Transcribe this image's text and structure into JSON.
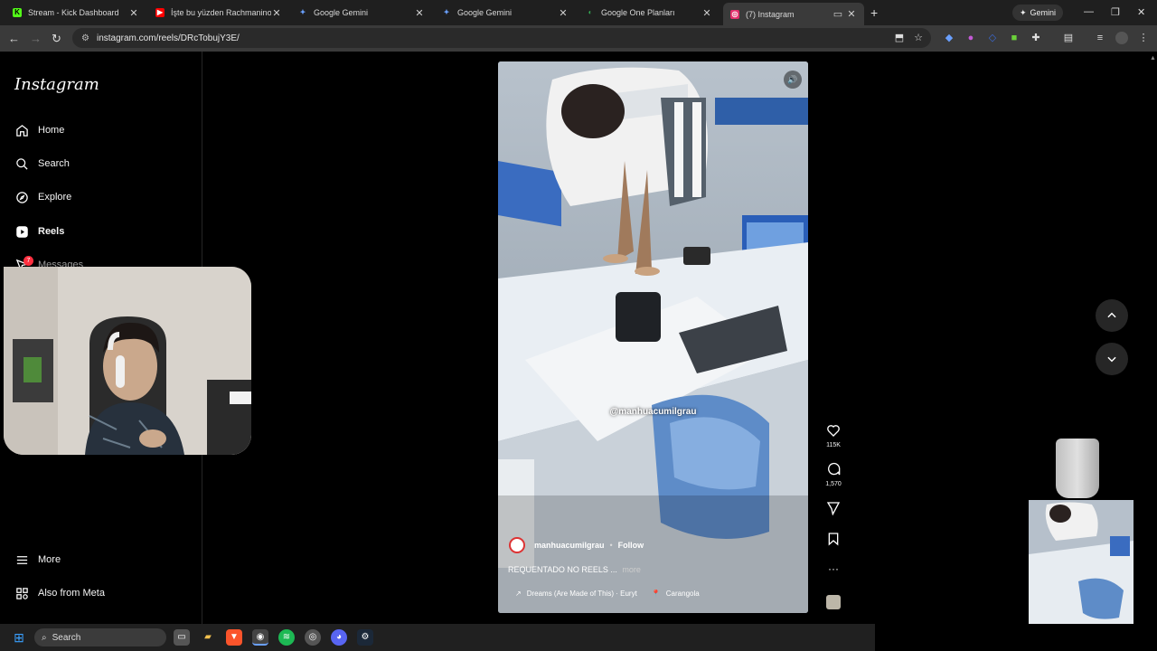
{
  "browser": {
    "tabs": [
      {
        "label": "Stream - Kick Dashboard",
        "icon": "kick-icon",
        "color": "#53fc18"
      },
      {
        "label": "İşte bu yüzden Rachmaninoff E",
        "icon": "youtube-icon",
        "color": "#ff0000"
      },
      {
        "label": "Google Gemini",
        "icon": "gemini-icon",
        "color": "#4a90e2"
      },
      {
        "label": "Google Gemini",
        "icon": "gemini-icon",
        "color": "#4a90e2"
      },
      {
        "label": "Google One Planları",
        "icon": "google-one-icon",
        "color": "#34a853"
      },
      {
        "label": "(7) Instagram",
        "icon": "instagram-icon",
        "color": "#e1306c"
      }
    ],
    "gemini_button": "Gemini",
    "url": "instagram.com/reels/DRcTobujY3E/"
  },
  "instagram": {
    "logo": "Instagram",
    "nav": [
      {
        "label": "Home",
        "icon": "home-icon"
      },
      {
        "label": "Search",
        "icon": "search-icon"
      },
      {
        "label": "Explore",
        "icon": "compass-icon"
      },
      {
        "label": "Reels",
        "icon": "reels-icon"
      },
      {
        "label": "Messages",
        "icon": "messages-icon"
      }
    ],
    "messages_badge": "7",
    "bottom_nav": [
      {
        "label": "More",
        "icon": "menu-icon"
      },
      {
        "label": "Also from Meta",
        "icon": "meta-grid-icon"
      }
    ]
  },
  "reel": {
    "watermark": "@manhuacumilgrau",
    "author": "manhuacumilgrau",
    "follow": "Follow",
    "caption": "REQUENTADO NO REELS ...",
    "caption_more": "more",
    "audio": "Dreams (Are Made of This) · Euryt",
    "location": "Carangola",
    "likes": "115K",
    "comments": "1,570"
  },
  "taskbar": {
    "search_placeholder": "Search"
  },
  "colors": {
    "accent": "#e1306c",
    "badge": "#ff3040",
    "chrome_dark": "#1f1f1f"
  }
}
